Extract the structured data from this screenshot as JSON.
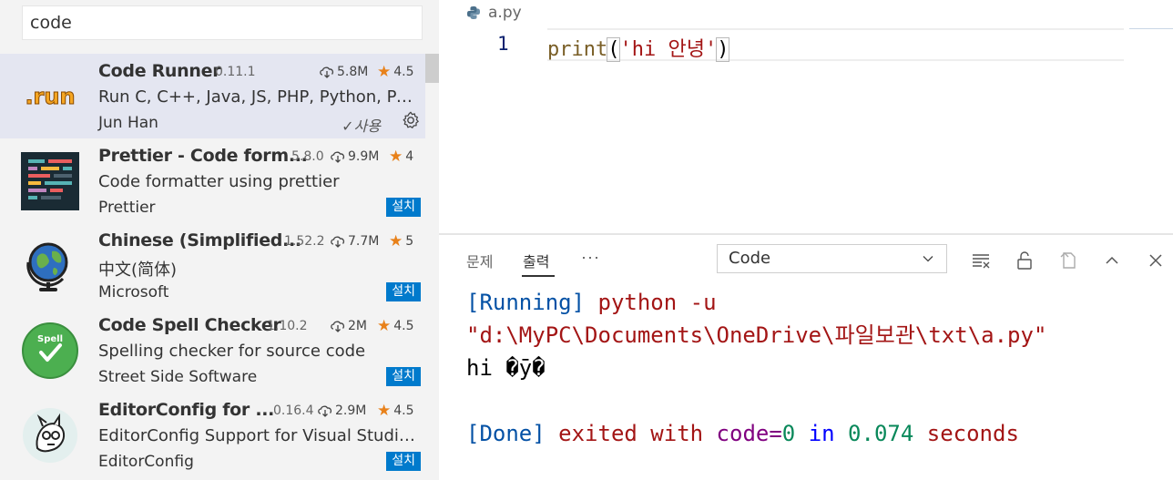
{
  "search": {
    "value": "code",
    "placeholder": ""
  },
  "extensions": [
    {
      "name": "Code Runner",
      "version": "0.11.1",
      "downloads": "5.8M",
      "rating": "4.5",
      "description": "Run C, C++, Java, JS, PHP, Python, Perl, ...",
      "publisher": "Jun Han",
      "status": "✓사용",
      "icon": "run-logo-icon",
      "icon_text": ".run"
    },
    {
      "name": "Prettier - Code form...",
      "version": "5.8.0",
      "downloads": "9.9M",
      "rating": "4",
      "description": "Code formatter using prettier",
      "publisher": "Prettier",
      "action": "설치",
      "icon": "prettier-logo-icon"
    },
    {
      "name": "Chinese (Simplified...",
      "version": "1.52.2",
      "downloads": "7.7M",
      "rating": "5",
      "description": "中文(简体)",
      "publisher": "Microsoft",
      "action": "설치",
      "icon": "globe-logo-icon"
    },
    {
      "name": "Code Spell Checker",
      "version": "1.10.2",
      "downloads": "2M",
      "rating": "4.5",
      "description": "Spelling checker for source code",
      "publisher": "Street Side Software",
      "action": "설치",
      "icon": "spell-check-logo-icon",
      "icon_text": "Spell"
    },
    {
      "name": "EditorConfig for ...",
      "version": "0.16.4",
      "downloads": "2.9M",
      "rating": "4.5",
      "description": "EditorConfig Support for Visual Studio ...",
      "publisher": "EditorConfig",
      "action": "설치",
      "icon": "editorconfig-logo-icon"
    }
  ],
  "editor": {
    "tab_title": "a.py",
    "line_number": "1",
    "code": {
      "func": "print",
      "open": "(",
      "str": "'hi 안녕'",
      "close": ")"
    }
  },
  "panel": {
    "tabs": [
      "문제",
      "출력"
    ],
    "active_tab": "출력",
    "more": "···",
    "channel": "Code",
    "output": {
      "running_tag": "[Running]",
      "command_1": " python -u",
      "command_2": "\"d:\\MyPC\\Documents\\OneDrive\\파일보관\\txt\\a.py\"",
      "result": "hi �ȳ�",
      "done_tag": "[Done]",
      "exited_with": " exited with ",
      "code_label": "code=",
      "code_value": "0",
      "in_word": " in ",
      "seconds_value": "0.074",
      "seconds_word": " seconds"
    }
  },
  "colors": {
    "accent": "#007acc",
    "star": "#e8811a",
    "selected_row": "#e4e6f1"
  }
}
